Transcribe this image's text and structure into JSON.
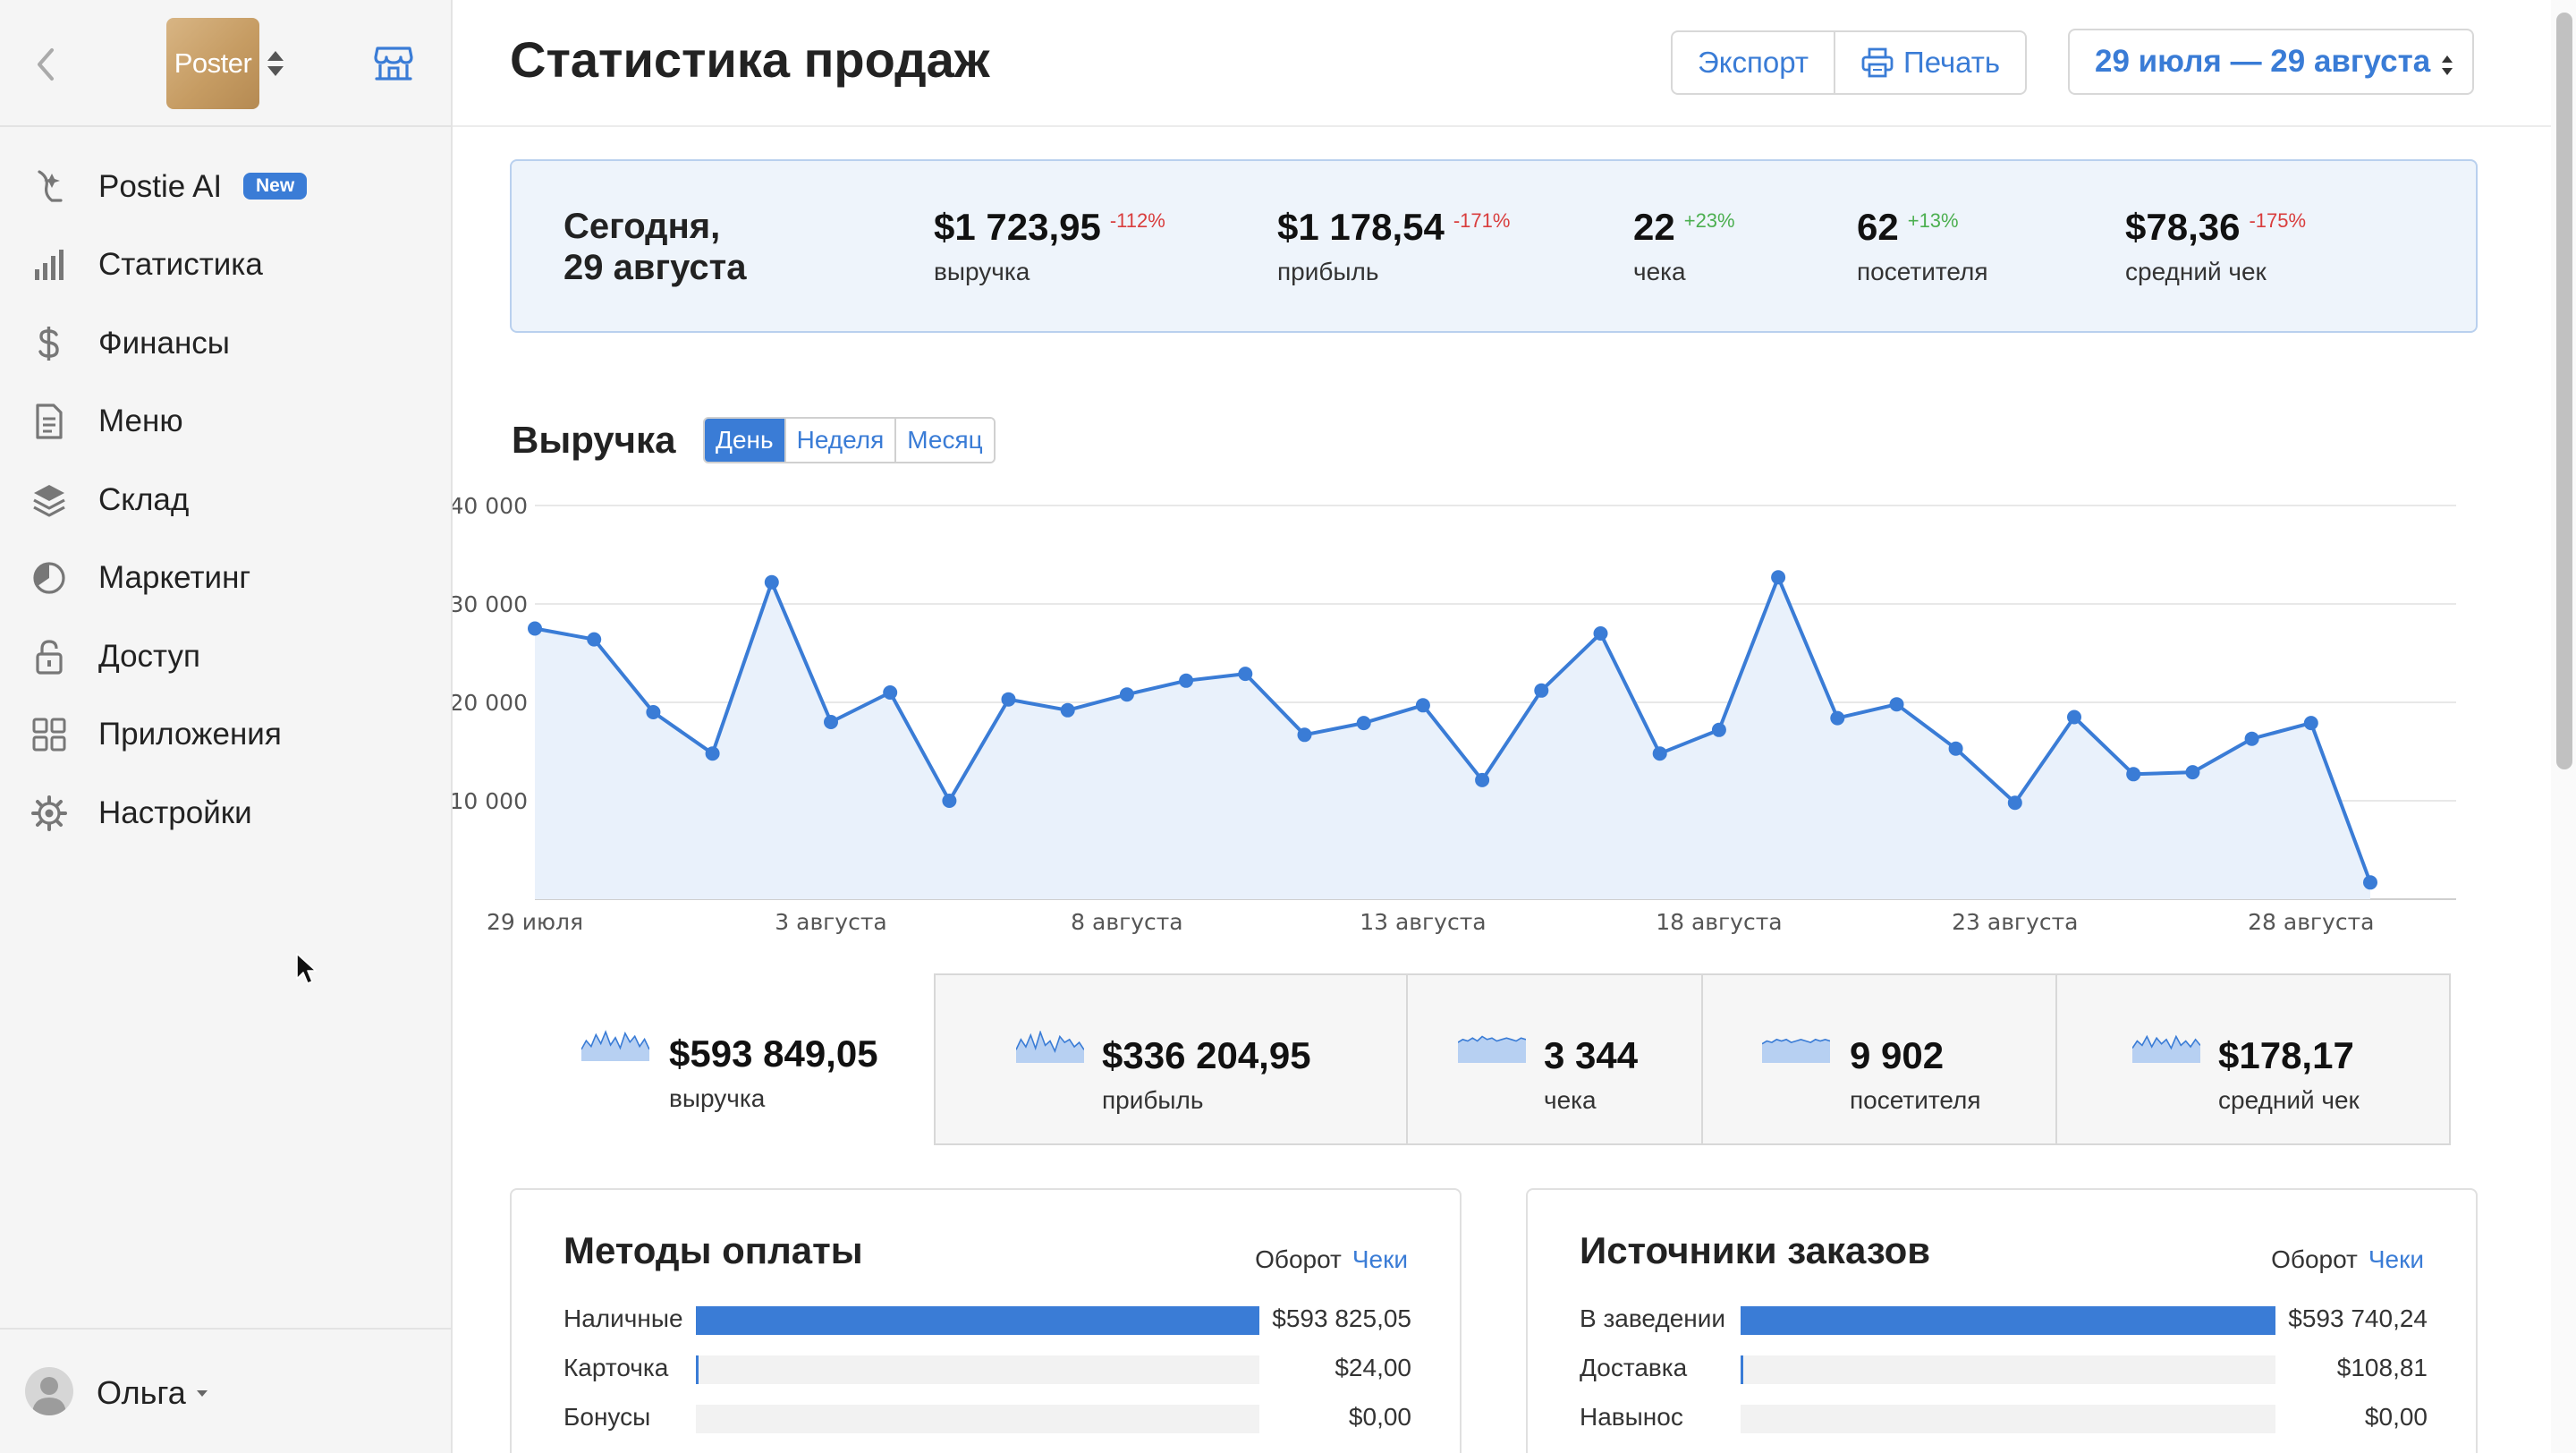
{
  "sidebar": {
    "logo_text": "Poster",
    "nav": [
      {
        "id": "postie-ai",
        "label": "Postie AI",
        "badge": "New",
        "icon": "postie-icon"
      },
      {
        "id": "statistics",
        "label": "Статистика",
        "icon": "bar-chart-icon"
      },
      {
        "id": "finance",
        "label": "Финансы",
        "icon": "dollar-icon"
      },
      {
        "id": "menu",
        "label": "Меню",
        "icon": "document-icon"
      },
      {
        "id": "warehouse",
        "label": "Склад",
        "icon": "layers-icon"
      },
      {
        "id": "marketing",
        "label": "Маркетинг",
        "icon": "pie-chart-icon"
      },
      {
        "id": "access",
        "label": "Доступ",
        "icon": "lock-icon"
      },
      {
        "id": "apps",
        "label": "Приложения",
        "icon": "grid-icon"
      },
      {
        "id": "settings",
        "label": "Настройки",
        "icon": "gear-icon"
      }
    ],
    "user": {
      "name": "Ольга"
    }
  },
  "header": {
    "title": "Статистика продаж",
    "export_label": "Экспорт",
    "print_label": "Печать",
    "date_range": "29 июля — 29 августа"
  },
  "today": {
    "label_line1": "Сегодня,",
    "label_line2": "29 августа",
    "stats": [
      {
        "value": "$1 723,95",
        "delta": "-112%",
        "trend": "neg",
        "caption": "выручка"
      },
      {
        "value": "$1 178,54",
        "delta": "-171%",
        "trend": "neg",
        "caption": "прибыль"
      },
      {
        "value": "22",
        "delta": "+23%",
        "trend": "pos",
        "caption": "чека"
      },
      {
        "value": "62",
        "delta": "+13%",
        "trend": "pos",
        "caption": "посетителя"
      },
      {
        "value": "$78,36",
        "delta": "-175%",
        "trend": "neg",
        "caption": "средний чек"
      }
    ]
  },
  "revenue": {
    "title": "Выручка",
    "tabs": [
      "День",
      "Неделя",
      "Месяц"
    ],
    "active_tab": "День"
  },
  "chart_data": {
    "type": "area",
    "title": "Выручка",
    "x_tick_labels": [
      "29 июля",
      "3 августа",
      "8 августа",
      "13 августа",
      "18 августа",
      "23 августа",
      "28 августа"
    ],
    "y_tick_labels": [
      "10 000",
      "20 000",
      "30 000",
      "40 000"
    ],
    "ylim": [
      0,
      40000
    ],
    "grid": true,
    "color": "#3a7cd6",
    "x": [
      "29 июля",
      "30 июля",
      "31 июля",
      "1 августа",
      "2 августа",
      "3 августа",
      "4 августа",
      "5 августа",
      "6 августа",
      "7 августа",
      "8 августа",
      "9 августа",
      "10 августа",
      "11 августа",
      "12 августа",
      "13 августа",
      "14 августа",
      "15 августа",
      "16 августа",
      "17 августа",
      "18 августа",
      "19 августа",
      "20 августа",
      "21 августа",
      "22 августа",
      "23 августа",
      "24 августа",
      "25 августа",
      "26 августа",
      "27 августа",
      "28 августа",
      "29 августа"
    ],
    "series": [
      {
        "values": [
          27500,
          26400,
          19000,
          14800,
          32200,
          18000,
          21000,
          10000,
          20300,
          19200,
          20800,
          22200,
          22900,
          16700,
          17900,
          19700,
          12100,
          21200,
          27000,
          14800,
          17200,
          32700,
          18400,
          19800,
          15300,
          9800,
          18500,
          12700,
          12900,
          16300,
          17900,
          1700
        ]
      }
    ]
  },
  "totals": [
    {
      "value": "$593 849,05",
      "caption": "выручка",
      "spark": [
        8,
        14,
        10,
        18,
        12,
        20,
        11,
        16,
        9,
        19,
        13,
        17,
        10,
        15,
        8
      ]
    },
    {
      "value": "$336 204,95",
      "caption": "прибыль",
      "spark": [
        9,
        16,
        11,
        19,
        10,
        21,
        12,
        15,
        8,
        18,
        14,
        16,
        11,
        14,
        9
      ]
    },
    {
      "value": "3 344",
      "caption": "чека",
      "spark": [
        14,
        16,
        15,
        17,
        15,
        18,
        16,
        17,
        15,
        16,
        17,
        16,
        15,
        17,
        16
      ]
    },
    {
      "value": "9 902",
      "caption": "посетителя",
      "spark": [
        13,
        15,
        14,
        16,
        15,
        16,
        14,
        15,
        16,
        15,
        14,
        16,
        15,
        16,
        15
      ]
    },
    {
      "value": "$178,17",
      "caption": "средний чек",
      "spark": [
        10,
        15,
        12,
        18,
        11,
        17,
        13,
        16,
        10,
        18,
        12,
        15,
        11,
        16,
        12
      ]
    }
  ],
  "payment_methods": {
    "title": "Методы оплаты",
    "toggle_a": "Оборот",
    "toggle_b": "Чеки",
    "rows": [
      {
        "label": "Наличные",
        "value": "$593 825,05",
        "share": 1.0
      },
      {
        "label": "Карточка",
        "value": "$24,00",
        "share": 0.004
      },
      {
        "label": "Бонусы",
        "value": "$0,00",
        "share": 0
      }
    ]
  },
  "order_sources": {
    "title": "Источники заказов",
    "toggle_a": "Оборот",
    "toggle_b": "Чеки",
    "rows": [
      {
        "label": "В заведении",
        "value": "$593 740,24",
        "share": 1.0
      },
      {
        "label": "Доставка",
        "value": "$108,81",
        "share": 0.004
      },
      {
        "label": "Навынос",
        "value": "$0,00",
        "share": 0
      }
    ]
  }
}
